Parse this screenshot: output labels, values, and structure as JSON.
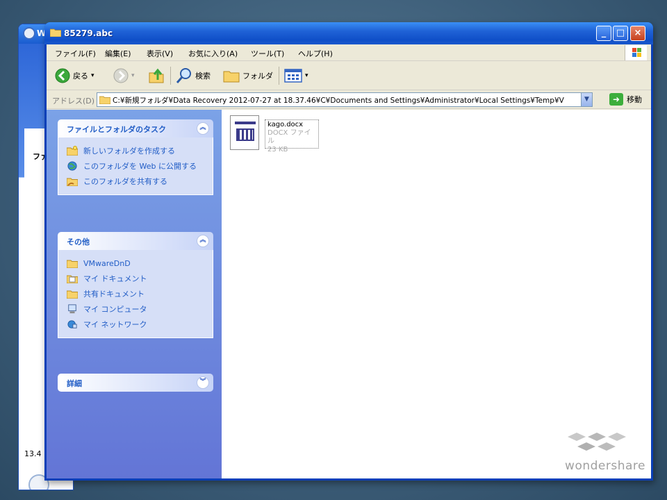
{
  "background_window": {
    "title_fragment": "W",
    "panel_fragment": "ファ",
    "status_fragment": "13.4"
  },
  "window": {
    "title": "85279.abc",
    "buttons": {
      "minimize": "_",
      "maximize": "□",
      "close": "×"
    }
  },
  "menu": {
    "items": [
      "ファイル(F)",
      "編集(E)",
      "表示(V)",
      "お気に入り(A)",
      "ツール(T)",
      "ヘルプ(H)"
    ]
  },
  "toolbar": {
    "back_label": "戻る",
    "search_label": "検索",
    "folders_label": "フォルダ"
  },
  "address": {
    "label": "アドレス(D)",
    "path": "C:¥新規フォルダ¥Data Recovery 2012-07-27 at 18.37.46¥C¥Documents and Settings¥Administrator¥Local Settings¥Temp¥V",
    "go_label": "移動"
  },
  "task_pane": {
    "file_tasks": {
      "title": "ファイルとフォルダのタスク",
      "items": [
        {
          "label": "新しいフォルダを作成する",
          "icon": "new-folder-icon"
        },
        {
          "label": "このフォルダを Web に公開する",
          "icon": "web-publish-icon"
        },
        {
          "label": "このフォルダを共有する",
          "icon": "share-folder-icon"
        }
      ]
    },
    "other_places": {
      "title": "その他",
      "items": [
        {
          "label": "VMwareDnD",
          "icon": "folder-icon"
        },
        {
          "label": "マイ ドキュメント",
          "icon": "my-documents-icon"
        },
        {
          "label": "共有ドキュメント",
          "icon": "shared-documents-icon"
        },
        {
          "label": "マイ コンピュータ",
          "icon": "my-computer-icon"
        },
        {
          "label": "マイ ネットワーク",
          "icon": "my-network-icon"
        }
      ]
    },
    "details": {
      "title": "詳細"
    }
  },
  "files": [
    {
      "name": "kago.docx",
      "type": "DOCX ファイル",
      "size": "23 KB"
    }
  ],
  "watermark": {
    "text": "wondershare"
  },
  "colors": {
    "title_bar": "#1f62d6",
    "task_pane": "#7ba2e7",
    "task_link": "#215dc6"
  }
}
